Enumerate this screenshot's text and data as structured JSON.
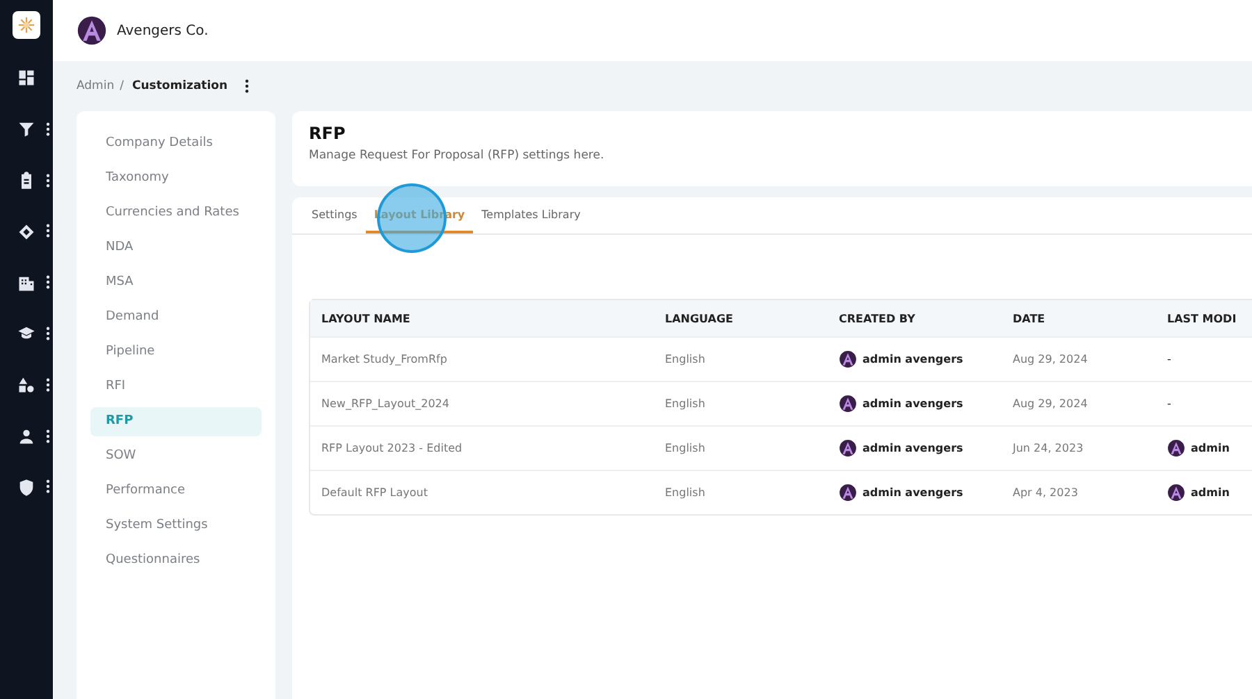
{
  "rail": {
    "items": [
      {
        "menu": false
      },
      {
        "menu": true
      },
      {
        "menu": true
      },
      {
        "menu": true
      },
      {
        "menu": true
      },
      {
        "menu": true
      },
      {
        "menu": true
      },
      {
        "menu": true
      },
      {
        "menu": true
      }
    ]
  },
  "topbar": {
    "company": "Avengers Co."
  },
  "breadcrumb": {
    "items": [
      "Admin",
      "Customization"
    ],
    "separator": "/"
  },
  "settings_nav": {
    "items": [
      {
        "label": "Company Details",
        "selected": false
      },
      {
        "label": "Taxonomy",
        "selected": false
      },
      {
        "label": "Currencies and Rates",
        "selected": false
      },
      {
        "label": "NDA",
        "selected": false
      },
      {
        "label": "MSA",
        "selected": false
      },
      {
        "label": "Demand",
        "selected": false
      },
      {
        "label": "Pipeline",
        "selected": false
      },
      {
        "label": "RFI",
        "selected": false
      },
      {
        "label": "RFP",
        "selected": true
      },
      {
        "label": "SOW",
        "selected": false
      },
      {
        "label": "Performance",
        "selected": false
      },
      {
        "label": "System Settings",
        "selected": false
      },
      {
        "label": "Questionnaires",
        "selected": false
      }
    ]
  },
  "header": {
    "title": "RFP",
    "subtitle": "Manage Request For Proposal (RFP) settings here."
  },
  "tabs": [
    {
      "label": "Settings",
      "selected": false
    },
    {
      "label": "Layout Library",
      "selected": true
    },
    {
      "label": "Templates Library",
      "selected": false
    }
  ],
  "table": {
    "columns": [
      "LAYOUT NAME",
      "LANGUAGE",
      "CREATED BY",
      "DATE",
      "LAST MODI"
    ],
    "rows": [
      {
        "name": "Market Study_FromRfp",
        "language": "English",
        "created_by": "admin avengers",
        "date": "Aug 29, 2024",
        "last_modified": "-"
      },
      {
        "name": "New_RFP_Layout_2024",
        "language": "English",
        "created_by": "admin avengers",
        "date": "Aug 29, 2024",
        "last_modified": "-"
      },
      {
        "name": "RFP Layout 2023 - Edited",
        "language": "English",
        "created_by": "admin avengers",
        "date": "Jun 24, 2023",
        "last_modified": "admin"
      },
      {
        "name": "Default RFP Layout",
        "language": "English",
        "created_by": "admin avengers",
        "date": "Apr 4, 2023",
        "last_modified": "admin"
      }
    ]
  }
}
